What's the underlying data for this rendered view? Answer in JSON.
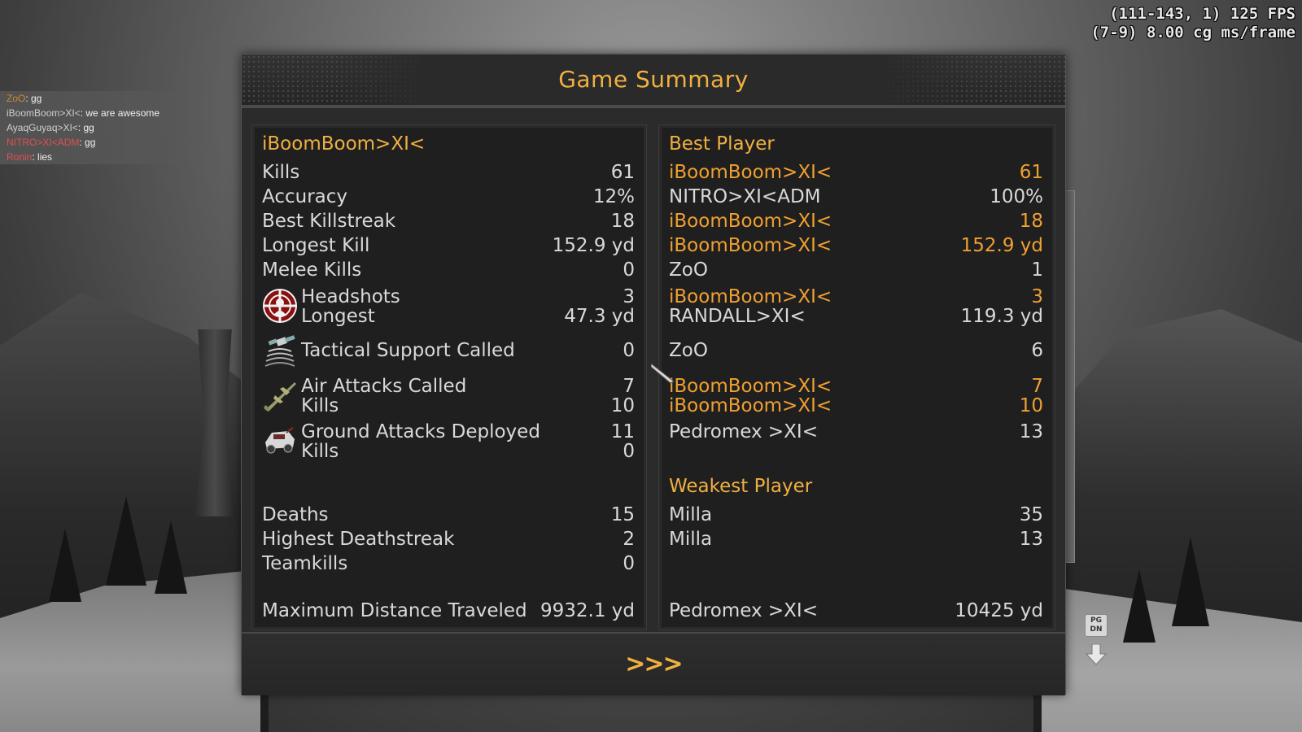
{
  "hud": {
    "fps_line1": "(111-143, 1) 125 FPS",
    "fps_line2": "(7-9) 8.00 cg ms/frame"
  },
  "chat": [
    {
      "name": "ZoO",
      "name_color": "orange",
      "message": ": gg"
    },
    {
      "name": "iBoomBoom>XI<",
      "name_color": "gray",
      "message": ": we are awesome"
    },
    {
      "name": "AyaqGuyaq>XI<",
      "name_color": "gray",
      "message": ": gg"
    },
    {
      "name": "NITRO>XI<ADM",
      "name_color": "red",
      "message": ": gg"
    },
    {
      "name": "Ronin",
      "name_color": "red",
      "message": ": lies"
    }
  ],
  "panel": {
    "title": "Game Summary",
    "next_label": ">>>"
  },
  "player": {
    "name": "iBoomBoom>XI<",
    "kills_label": "Kills",
    "kills": "61",
    "accuracy_label": "Accuracy",
    "accuracy": "12%",
    "killstreak_label": "Best Killstreak",
    "killstreak": "18",
    "longest_kill_label": "Longest Kill",
    "longest_kill": "152.9 yd",
    "melee_label": "Melee Kills",
    "melee": "0",
    "headshots_label": "Headshots",
    "headshots": "3",
    "hs_longest_label": "Longest",
    "hs_longest": "47.3 yd",
    "tactical_label": "Tactical Support Called",
    "tactical": "0",
    "air_label": "Air Attacks Called",
    "air": "7",
    "air_kills_label": "Kills",
    "air_kills": "10",
    "ground_label": "Ground Attacks Deployed",
    "ground": "11",
    "ground_kills_label": "Kills",
    "ground_kills": "0",
    "deaths_label": "Deaths",
    "deaths": "15",
    "deathstreak_label": "Highest Deathstreak",
    "deathstreak": "2",
    "teamkills_label": "Teamkills",
    "teamkills": "0",
    "distance_label": "Maximum Distance Traveled",
    "distance": "9932.1 yd"
  },
  "best": {
    "heading": "Best Player",
    "kills": {
      "name": "iBoomBoom>XI<",
      "value": "61"
    },
    "accuracy": {
      "name": "NITRO>XI<ADM",
      "value": "100%"
    },
    "killstreak": {
      "name": "iBoomBoom>XI<",
      "value": "18"
    },
    "longest_kill": {
      "name": "iBoomBoom>XI<",
      "value": "152.9 yd"
    },
    "melee": {
      "name": "ZoO",
      "value": "1"
    },
    "headshots": {
      "name": "iBoomBoom>XI<",
      "value": "3"
    },
    "hs_longest": {
      "name": "RANDALL>XI<",
      "value": "119.3 yd"
    },
    "tactical": {
      "name": "ZoO",
      "value": "6"
    },
    "air": {
      "name": "iBoomBoom>XI<",
      "value": "7"
    },
    "air_kills": {
      "name": "iBoomBoom>XI<",
      "value": "10"
    },
    "ground": {
      "name": "Pedromex >XI<",
      "value": "13"
    }
  },
  "weakest": {
    "heading": "Weakest Player",
    "deaths": {
      "name": "Milla",
      "value": "35"
    },
    "deathstreak": {
      "name": "Milla",
      "value": "13"
    },
    "distance": {
      "name": "Pedromex >XI<",
      "value": "10425 yd"
    }
  },
  "key_hint": {
    "label_line1": "PG",
    "label_line2": "DN"
  },
  "colors": {
    "accent": "#f0b040",
    "highlight": "#f0a030",
    "text": "#d9d9d9",
    "panel": "#1f1f20"
  }
}
